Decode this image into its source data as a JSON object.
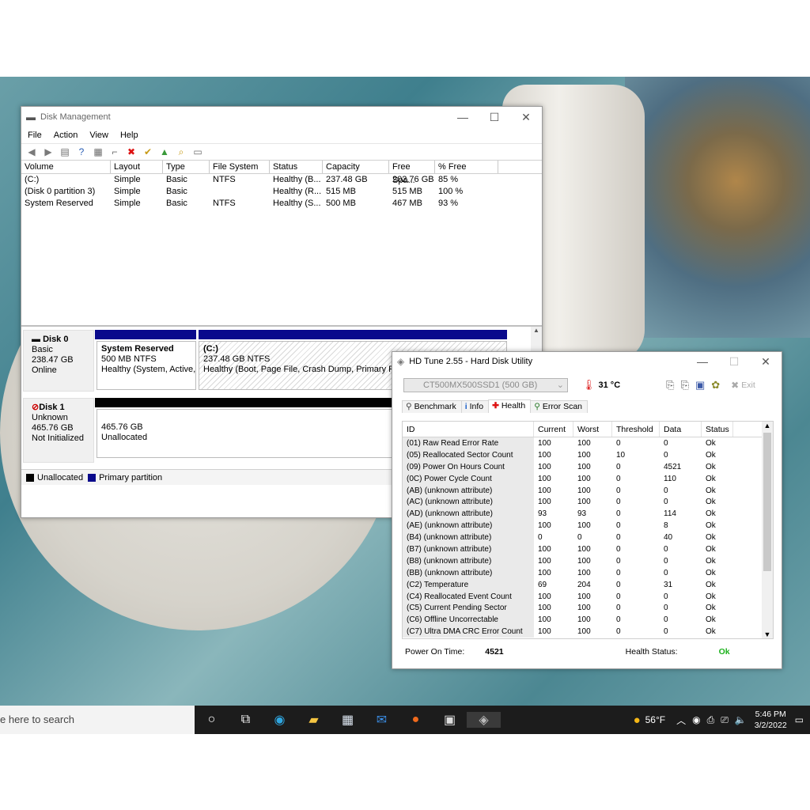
{
  "disk_management": {
    "title": "Disk Management",
    "menu": [
      "File",
      "Action",
      "View",
      "Help"
    ],
    "columns": [
      "Volume",
      "Layout",
      "Type",
      "File System",
      "Status",
      "Capacity",
      "Free Spa...",
      "% Free"
    ],
    "volumes": [
      [
        "(C:)",
        "Simple",
        "Basic",
        "NTFS",
        "Healthy (B...",
        "237.48 GB",
        "202.76 GB",
        "85 %"
      ],
      [
        "(Disk 0 partition 3)",
        "Simple",
        "Basic",
        "",
        "Healthy (R...",
        "515 MB",
        "515 MB",
        "100 %"
      ],
      [
        "System Reserved",
        "Simple",
        "Basic",
        "NTFS",
        "Healthy (S...",
        "500 MB",
        "467 MB",
        "93 %"
      ]
    ],
    "disk0": {
      "name": "Disk 0",
      "type": "Basic",
      "size": "238.47 GB",
      "state": "Online"
    },
    "disk1": {
      "name": "Disk 1",
      "type": "Unknown",
      "size": "465.76 GB",
      "state": "Not Initialized"
    },
    "part_sysres": {
      "name": "System Reserved",
      "size": "500 MB NTFS",
      "status": "Healthy (System, Active,"
    },
    "part_c": {
      "name": "(C:)",
      "size": "237.48 GB NTFS",
      "status": "Healthy (Boot, Page File, Crash Dump, Primary Parti"
    },
    "part_unalloc": {
      "size": "465.76 GB",
      "status": "Unallocated"
    },
    "legend": {
      "unallocated": "Unallocated",
      "primary": "Primary partition"
    },
    "colors": {
      "primary": "#0a0a8c",
      "unallocated": "#000000"
    }
  },
  "hdtune": {
    "title": "HD Tune 2.55 - Hard Disk Utility",
    "drive": "CT500MX500SSD1 (500 GB)",
    "temperature": "31 °C",
    "exit": "Exit",
    "tabs": [
      "Benchmark",
      "Info",
      "Health",
      "Error Scan"
    ],
    "columns": [
      "ID",
      "Current",
      "Worst",
      "Threshold",
      "Data",
      "Status"
    ],
    "rows": [
      [
        "(01) Raw Read Error Rate",
        "100",
        "100",
        "0",
        "0",
        "Ok"
      ],
      [
        "(05) Reallocated Sector Count",
        "100",
        "100",
        "10",
        "0",
        "Ok"
      ],
      [
        "(09) Power On Hours Count",
        "100",
        "100",
        "0",
        "4521",
        "Ok"
      ],
      [
        "(0C) Power Cycle Count",
        "100",
        "100",
        "0",
        "110",
        "Ok"
      ],
      [
        "(AB) (unknown attribute)",
        "100",
        "100",
        "0",
        "0",
        "Ok"
      ],
      [
        "(AC) (unknown attribute)",
        "100",
        "100",
        "0",
        "0",
        "Ok"
      ],
      [
        "(AD) (unknown attribute)",
        "93",
        "93",
        "0",
        "114",
        "Ok"
      ],
      [
        "(AE) (unknown attribute)",
        "100",
        "100",
        "0",
        "8",
        "Ok"
      ],
      [
        "(B4) (unknown attribute)",
        "0",
        "0",
        "0",
        "40",
        "Ok"
      ],
      [
        "(B7) (unknown attribute)",
        "100",
        "100",
        "0",
        "0",
        "Ok"
      ],
      [
        "(B8) (unknown attribute)",
        "100",
        "100",
        "0",
        "0",
        "Ok"
      ],
      [
        "(BB) (unknown attribute)",
        "100",
        "100",
        "0",
        "0",
        "Ok"
      ],
      [
        "(C2) Temperature",
        "69",
        "204",
        "0",
        "31",
        "Ok"
      ],
      [
        "(C4) Reallocated Event Count",
        "100",
        "100",
        "0",
        "0",
        "Ok"
      ],
      [
        "(C5) Current Pending Sector",
        "100",
        "100",
        "0",
        "0",
        "Ok"
      ],
      [
        "(C6) Offline Uncorrectable",
        "100",
        "100",
        "0",
        "0",
        "Ok"
      ],
      [
        "(C7) Ultra DMA CRC Error Count",
        "100",
        "100",
        "0",
        "0",
        "Ok"
      ]
    ],
    "power_on_label": "Power On Time:",
    "power_on_value": "4521",
    "health_label": "Health Status:",
    "health_value": "Ok",
    "colors": {
      "ok": "#1db21d"
    }
  },
  "taskbar": {
    "search_text": "e here to search",
    "weather": "56°F",
    "time": "5:46 PM",
    "date": "3/2/2022"
  }
}
